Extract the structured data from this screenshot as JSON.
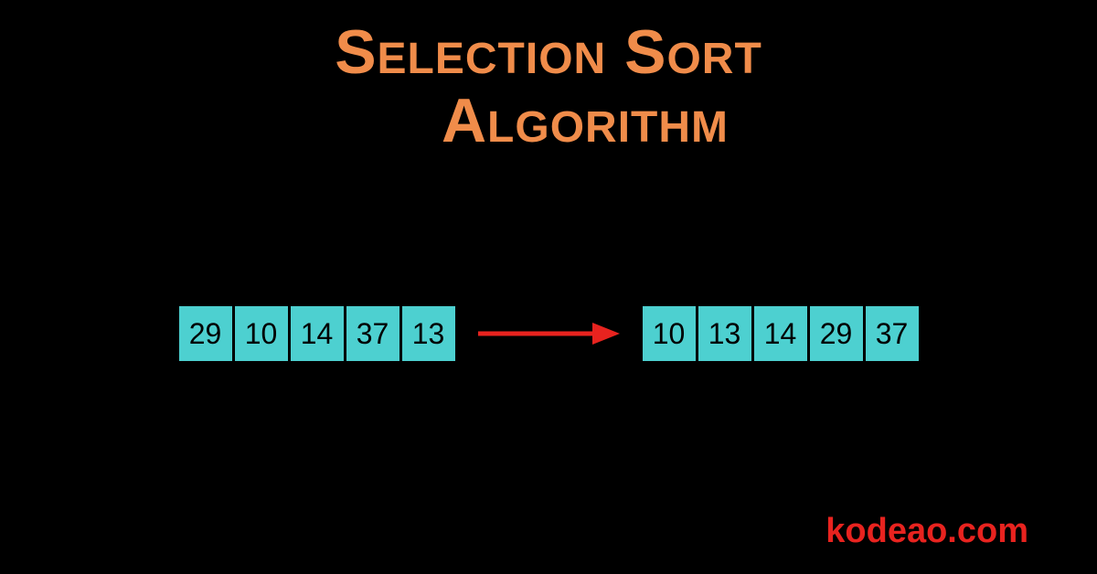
{
  "title": {
    "line1": "Selection Sort",
    "line2": "Algorithm"
  },
  "arrays": {
    "unsorted": [
      "29",
      "10",
      "14",
      "37",
      "13"
    ],
    "sorted": [
      "10",
      "13",
      "14",
      "29",
      "37"
    ]
  },
  "footer": "kodeao.com",
  "colors": {
    "background": "#000000",
    "title": "#f08c4a",
    "cell": "#4dd0d0",
    "cellText": "#000000",
    "arrow": "#e8231f",
    "footer": "#e8231f"
  }
}
